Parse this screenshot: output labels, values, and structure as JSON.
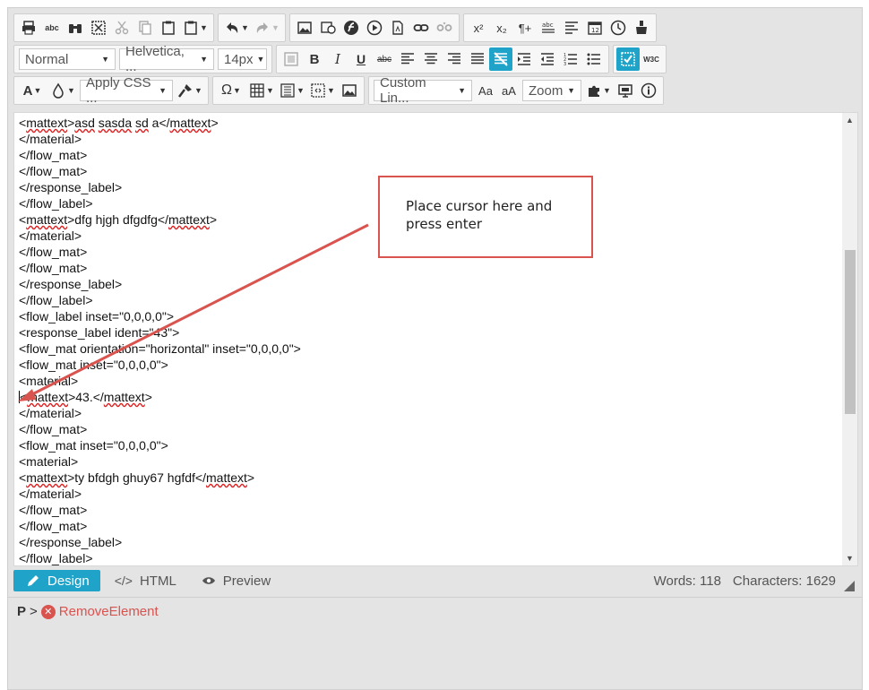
{
  "toolbar": {
    "format_select": "Normal",
    "font_select": "Helvetica, ...",
    "size_select": "14px",
    "css_select": "Apply CSS ...",
    "link_select": "Custom Lin...",
    "zoom_select": "Zoom",
    "font_color_label": "A",
    "spell_label": "abc",
    "superscript_label": "x²",
    "subscript_label": "x₂",
    "pilcrow_label": "¶+",
    "bold_label": "B",
    "italic_label": "I",
    "underline_label": "U",
    "strike_label": "abc",
    "case_upper_label": "Aa",
    "case_lower_label": "aA",
    "w3c_label": "W3C",
    "omega_label": "Ω",
    "accent_color": "#1fa3c9"
  },
  "content": {
    "lines": [
      "<mattext>asd sasda sd a</mattext>",
      "</material>",
      "</flow_mat>",
      "</flow_mat>",
      "</response_label>",
      "</flow_label>",
      "<mattext>dfg hjgh dfgdfg</mattext>",
      "</material>",
      "</flow_mat>",
      "</flow_mat>",
      "</response_label>",
      "</flow_label>",
      "<flow_label inset=\"0,0,0,0\">",
      "<response_label ident=\"43\">",
      "<flow_mat orientation=\"horizontal\" inset=\"0,0,0,0\">",
      "<flow_mat inset=\"0,0,0,0\">",
      "<material>",
      "<mattext>43.</mattext>",
      "</material>",
      "</flow_mat>",
      "<flow_mat inset=\"0,0,0,0\">",
      "<material>",
      "<mattext>ty bfdgh ghuy67 hgfdf</mattext>",
      "</material>",
      "</flow_mat>",
      "</flow_mat>",
      "</response_label>",
      "</flow_label>"
    ]
  },
  "callout": {
    "text_line1": "Place cursor here and",
    "text_line2": "press enter",
    "color": "#d9534f"
  },
  "modes": {
    "design": "Design",
    "html": "HTML",
    "preview": "Preview"
  },
  "stats": {
    "words": "Words: 118",
    "characters": "Characters: 1629"
  },
  "path": {
    "tag": "P",
    "separator": ">",
    "remove_label": "RemoveElement"
  }
}
